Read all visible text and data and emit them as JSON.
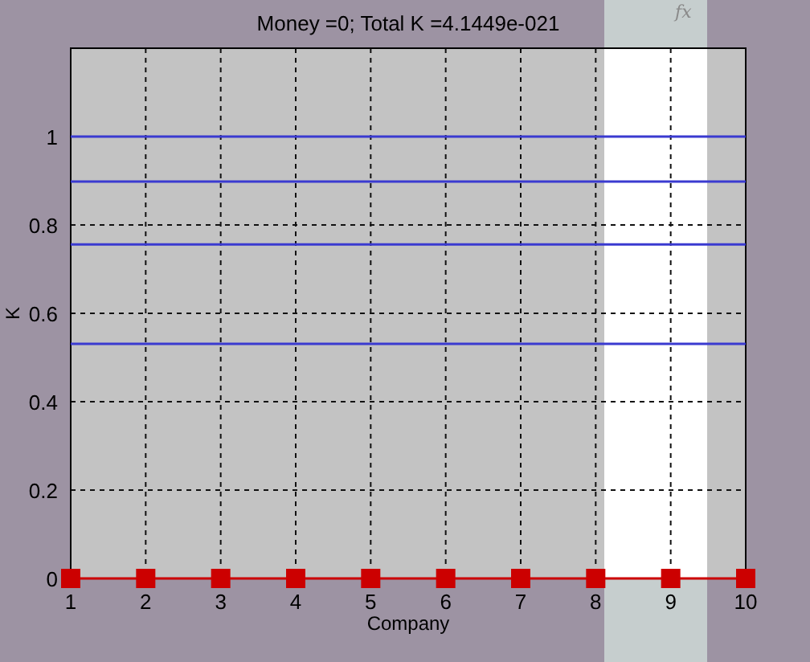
{
  "toolbar": {
    "fx": "fx"
  },
  "figure": {
    "chart_data": {
      "type": "line",
      "title": "Money =0; Total K =4.1449e-021",
      "xlabel": "Company",
      "ylabel": "K",
      "x": [
        1,
        2,
        3,
        4,
        5,
        6,
        7,
        8,
        9,
        10
      ],
      "series": [
        {
          "marker": "square",
          "color": "#cc0000",
          "values": [
            0,
            0,
            0,
            0,
            0,
            0,
            0,
            0,
            0,
            0
          ]
        },
        {
          "color": "#3a3ad0",
          "values": [
            1,
            1,
            1,
            1,
            1,
            1,
            1,
            1,
            1,
            1
          ]
        },
        {
          "color": "#3a3ad0",
          "values": [
            0.898,
            0.898,
            0.898,
            0.898,
            0.898,
            0.898,
            0.898,
            0.898,
            0.898,
            0.898
          ]
        },
        {
          "color": "#3a3ad0",
          "values": [
            0.756,
            0.756,
            0.756,
            0.756,
            0.756,
            0.756,
            0.756,
            0.756,
            0.756,
            0.756
          ]
        },
        {
          "color": "#3a3ad0",
          "values": [
            0.531,
            0.531,
            0.531,
            0.531,
            0.531,
            0.531,
            0.531,
            0.531,
            0.531,
            0.531
          ]
        }
      ],
      "xlim": [
        1,
        10
      ],
      "ylim": [
        0,
        1.2
      ],
      "grid": true,
      "xticks": [
        1,
        2,
        3,
        4,
        5,
        6,
        7,
        8,
        9,
        10
      ],
      "yticks": [
        {
          "value": 0,
          "label": "0"
        },
        {
          "value": 0.2,
          "label": "0.2"
        },
        {
          "value": 0.4,
          "label": "0.4"
        },
        {
          "value": 0.6,
          "label": "0.6"
        },
        {
          "value": 0.8,
          "label": "0.8"
        },
        {
          "value": 1,
          "label": "1"
        }
      ]
    }
  }
}
